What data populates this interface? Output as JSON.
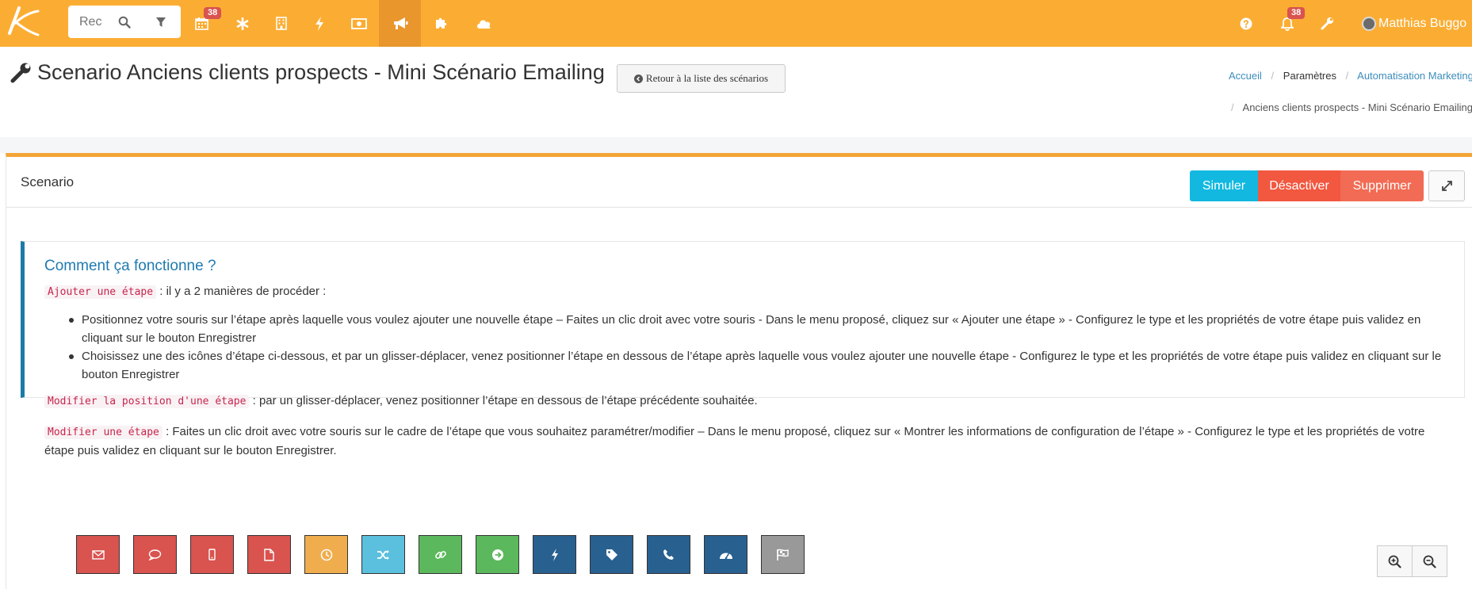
{
  "search": {
    "placeholder": "Rec"
  },
  "topnav": {
    "calendar_badge": "38",
    "notifications_badge": "38",
    "user_name": "Matthias Buggo"
  },
  "header": {
    "title": "Scenario Anciens clients prospects - Mini Scénario Emailing",
    "back_button": "Retour à la liste des scénarios",
    "breadcrumb": {
      "home": "Accueil",
      "settings": "Paramètres",
      "automation": "Automatisation Marketing",
      "current": "Anciens clients prospects - Mini Scénario Emailing"
    }
  },
  "panel": {
    "title": "Scenario",
    "buttons": {
      "simulate": "Simuler",
      "deactivate": "Désactiver",
      "delete": "Supprimer"
    }
  },
  "help": {
    "title": "Comment ça fonctionne ?",
    "add_code": "Ajouter une étape",
    "add_text": ": il y a 2 manières de procéder :",
    "bullet1": "Positionnez votre souris sur l’étape après laquelle vous voulez ajouter une nouvelle étape – Faites un clic droit avec votre souris - Dans le menu proposé, cliquez sur « Ajouter une étape » - Configurez le type et les propriétés de votre étape puis validez en cliquant sur le bouton Enregistrer",
    "bullet2": "Choisissez une des icônes d’étape ci-dessous, et par un glisser-déplacer, venez positionner l’étape en dessous de l’étape après laquelle vous voulez ajouter une nouvelle étape - Configurez le type et les propriétés de votre étape puis validez en cliquant sur le bouton Enregistrer",
    "move_code": "Modifier la position d'une étape",
    "move_text": ": par un glisser-déplacer, venez positionner l’étape en dessous de l’étape précédente souhaitée.",
    "edit_code": "Modifier une étape",
    "edit_text": ": Faites un clic droit avec votre souris sur le cadre de l’étape que vous souhaitez paramétrer/modifier – Dans le menu proposé, cliquez sur « Montrer les informations de configuration de l’étape » - Configurez le type et les propriétés de votre étape puis validez en cliquant sur le bouton Enregistrer."
  },
  "steps": [
    {
      "icon": "envelope-icon",
      "color": "#d9534f"
    },
    {
      "icon": "comment-icon",
      "color": "#d9534f"
    },
    {
      "icon": "mobile-icon",
      "color": "#d9534f"
    },
    {
      "icon": "file-icon",
      "color": "#d9534f"
    },
    {
      "icon": "clock-icon",
      "color": "#f0ad4e"
    },
    {
      "icon": "random-icon",
      "color": "#5bc0de"
    },
    {
      "icon": "link-icon",
      "color": "#5cb85c"
    },
    {
      "icon": "arrow-circle-icon",
      "color": "#5cb85c"
    },
    {
      "icon": "bolt-icon",
      "color": "#286090"
    },
    {
      "icon": "tag-icon",
      "color": "#286090"
    },
    {
      "icon": "phone-icon",
      "color": "#286090"
    },
    {
      "icon": "dashboard-icon",
      "color": "#286090"
    },
    {
      "icon": "flag-icon",
      "color": "#999999"
    }
  ]
}
